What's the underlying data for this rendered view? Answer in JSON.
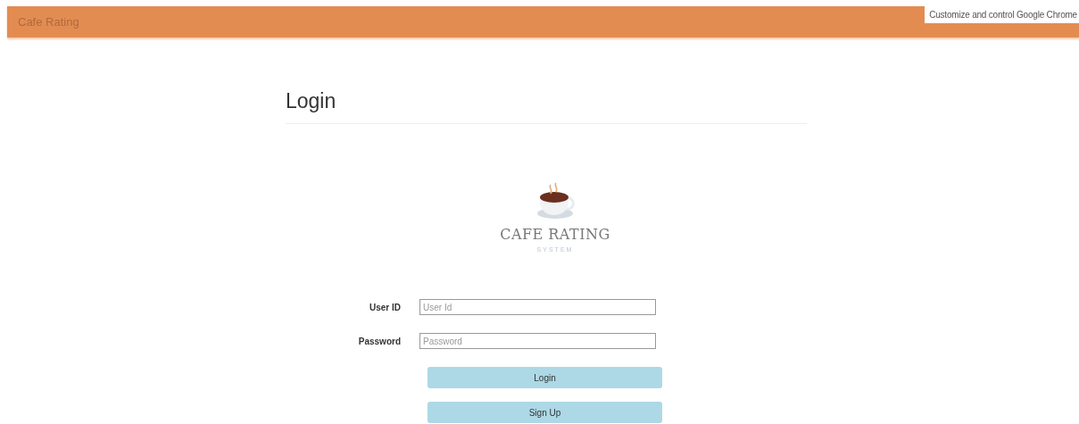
{
  "navbar": {
    "brand": "Cafe Rating"
  },
  "tooltip": "Customize and control Google Chrome",
  "page": {
    "title": "Login"
  },
  "logo": {
    "name": "CAFE RATING",
    "subtitle": "SYSTEM"
  },
  "form": {
    "fields": [
      {
        "label": "User ID",
        "placeholder": "User Id"
      },
      {
        "label": "Password",
        "placeholder": "Password"
      }
    ],
    "buttons": [
      "Login",
      "Sign Up"
    ]
  }
}
